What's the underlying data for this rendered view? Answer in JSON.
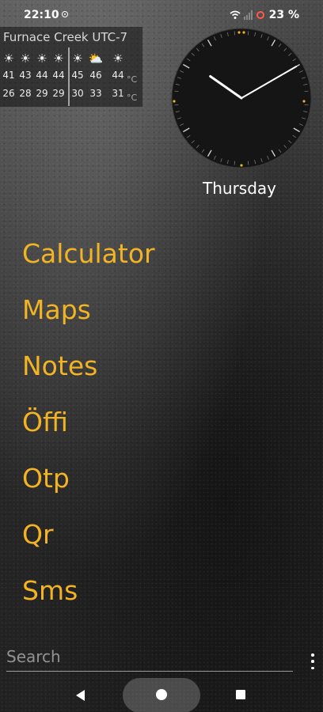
{
  "status_bar": {
    "time": "22:10",
    "battery_percent": "23 %",
    "battery_color": "#ff5a4a"
  },
  "weather": {
    "location": "Furnace Creek UTC-7",
    "unit": "°C",
    "days": [
      {
        "icon": "sun-icon",
        "glyph": "☀",
        "high": "41",
        "low": "26"
      },
      {
        "icon": "sun-icon",
        "glyph": "☀",
        "high": "43",
        "low": "28"
      },
      {
        "icon": "sun-icon",
        "glyph": "☀",
        "high": "44",
        "low": "29"
      },
      {
        "icon": "sun-icon",
        "glyph": "☀",
        "high": "44",
        "low": "29"
      },
      {
        "icon": "sun-icon",
        "glyph": "☀",
        "high": "45",
        "low": "30"
      },
      {
        "icon": "partly-cloudy-icon",
        "glyph": "⛅",
        "high": "46",
        "low": "33"
      },
      {
        "icon": "sun-icon",
        "glyph": "☀",
        "high": "44",
        "low": "31"
      }
    ]
  },
  "clock": {
    "time": "22:10",
    "day": "Thursday",
    "accent": "#f2b324"
  },
  "apps": {
    "accent": "#f2b324",
    "items": [
      {
        "label": "Calculator"
      },
      {
        "label": "Maps"
      },
      {
        "label": "Notes"
      },
      {
        "label": "Öffi"
      },
      {
        "label": "Otp"
      },
      {
        "label": "Qr"
      },
      {
        "label": "Sms"
      }
    ]
  },
  "search": {
    "placeholder": "Search",
    "value": ""
  },
  "nav": {
    "back_icon": "back-icon",
    "home_icon": "home-icon",
    "recents_icon": "recents-icon"
  }
}
